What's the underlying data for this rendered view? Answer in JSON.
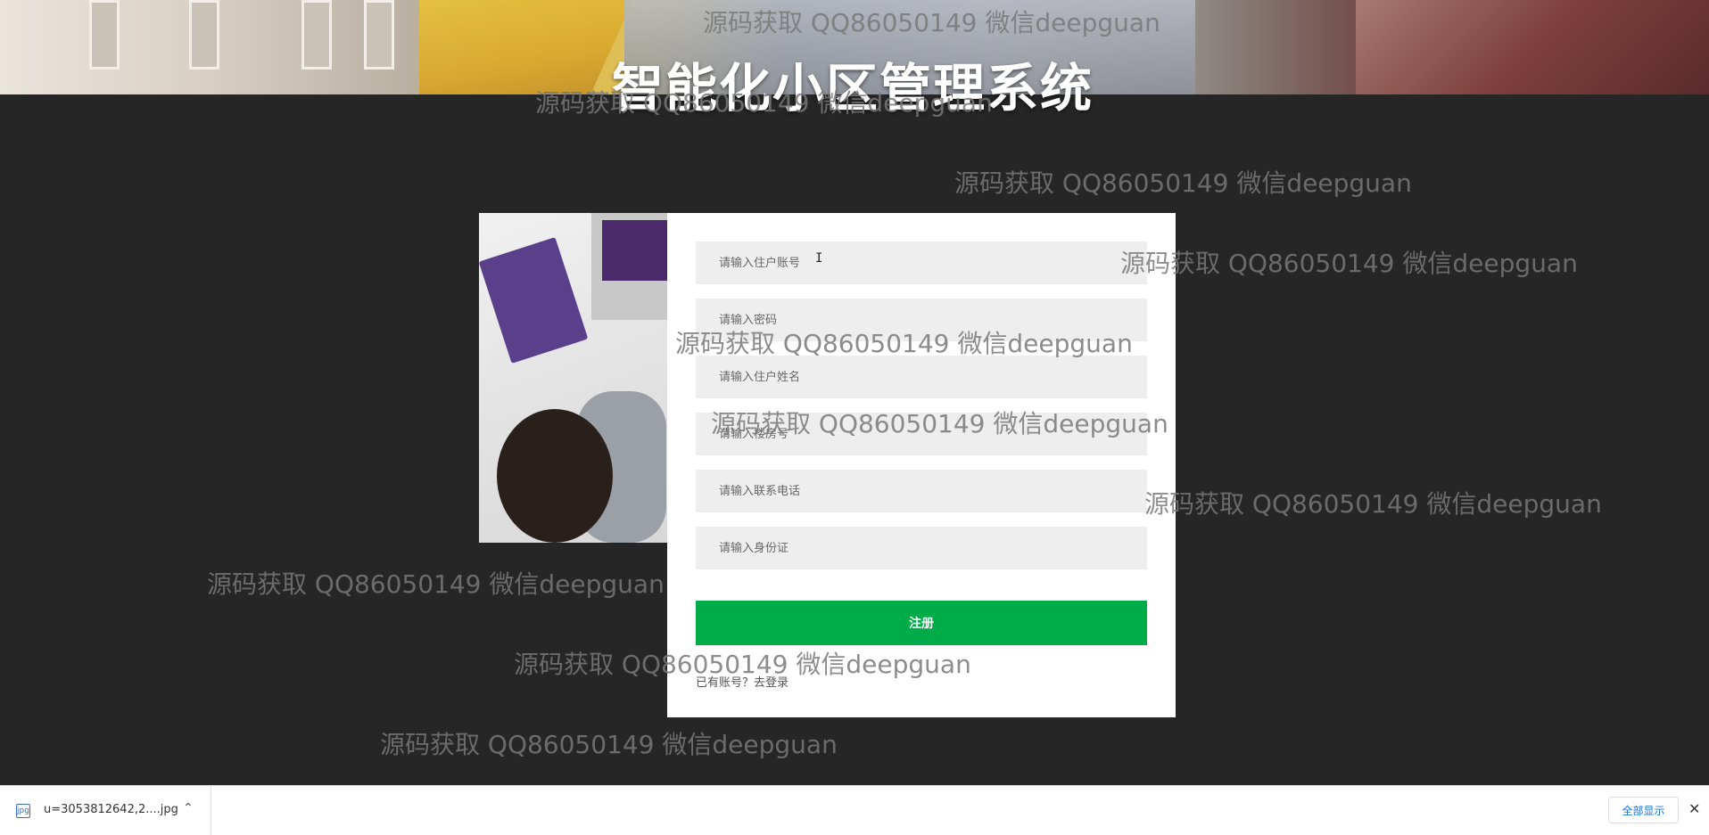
{
  "header": {
    "title": "智能化小区管理系统"
  },
  "form": {
    "fields": [
      {
        "placeholder": "请输入住户账号"
      },
      {
        "placeholder": "请输入密码"
      },
      {
        "placeholder": "请输入住户姓名"
      },
      {
        "placeholder": "请输入楼房号"
      },
      {
        "placeholder": "请输入联系电话"
      },
      {
        "placeholder": "请输入身份证"
      }
    ],
    "submit_label": "注册",
    "login_link": "已有账号？去登录"
  },
  "watermark": {
    "text": "源码获取 QQ86050149 微信deepguan"
  },
  "download_bar": {
    "file_name": "u=3053812642,2....jpg",
    "show_all": "全部显示",
    "colors": {
      "accent": "#1a73e8"
    }
  },
  "colors": {
    "background": "#262626",
    "submit": "#00ac47",
    "field_bg": "#eeeeee"
  }
}
